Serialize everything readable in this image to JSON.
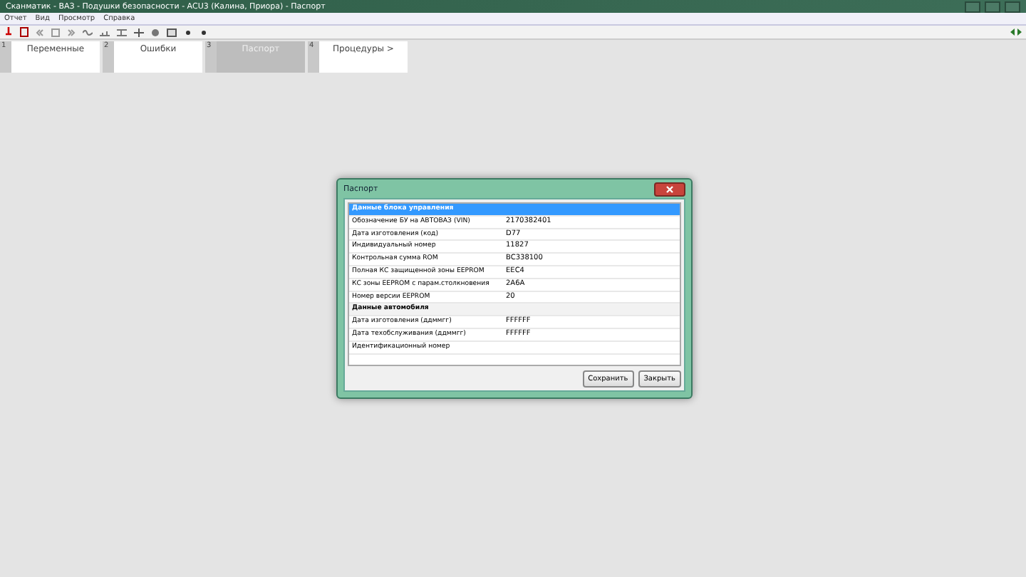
{
  "window": {
    "title": "Сканматик - ВАЗ - Подушки безопасности - ACU3 (Калина, Приора) - Паспорт"
  },
  "menu": [
    "Отчет",
    "Вид",
    "Просмотр",
    "Справка"
  ],
  "tabs": [
    {
      "number": "1",
      "label": "Переменные",
      "selected": false
    },
    {
      "number": "2",
      "label": "Ошибки",
      "selected": false
    },
    {
      "number": "3",
      "label": "Паспорт",
      "selected": true
    },
    {
      "number": "4",
      "label": "Процедуры >",
      "selected": false
    }
  ],
  "dialog": {
    "title": "Паспорт",
    "rows": [
      {
        "kind": "section",
        "name": "Данные блока управления",
        "selected": true
      },
      {
        "kind": "row",
        "name": "Обозначение БУ на АВТОВАЗ (VIN)",
        "value": "2170382401",
        "selected": false
      },
      {
        "kind": "row",
        "name": "Дата изготовления (код)",
        "value": "D77",
        "selected": false
      },
      {
        "kind": "row",
        "name": "Индивидуальный номер",
        "value": "11827",
        "selected": false
      },
      {
        "kind": "row",
        "name": "Контрольная сумма ROM",
        "value": "BC338100",
        "selected": false
      },
      {
        "kind": "row",
        "name": "Полная КС защищенной зоны EEPROM",
        "value": "EEC4",
        "selected": false
      },
      {
        "kind": "row",
        "name": "КС зоны EEPROM с парам.столкновения",
        "value": "2A6A",
        "selected": false
      },
      {
        "kind": "row",
        "name": "Номер версии EEPROM",
        "value": "20",
        "selected": false
      },
      {
        "kind": "section",
        "name": "Данные автомобиля",
        "selected": false
      },
      {
        "kind": "row",
        "name": "Дата изготовления (ддммгг)",
        "value": "FFFFFF",
        "selected": false
      },
      {
        "kind": "row",
        "name": "Дата техобслуживания (ддммгг)",
        "value": "FFFFFF",
        "selected": false
      },
      {
        "kind": "row",
        "name": "Идентификационный номер",
        "selected": false
      }
    ],
    "buttons": [
      "Сохранить",
      "Закрыть"
    ]
  }
}
